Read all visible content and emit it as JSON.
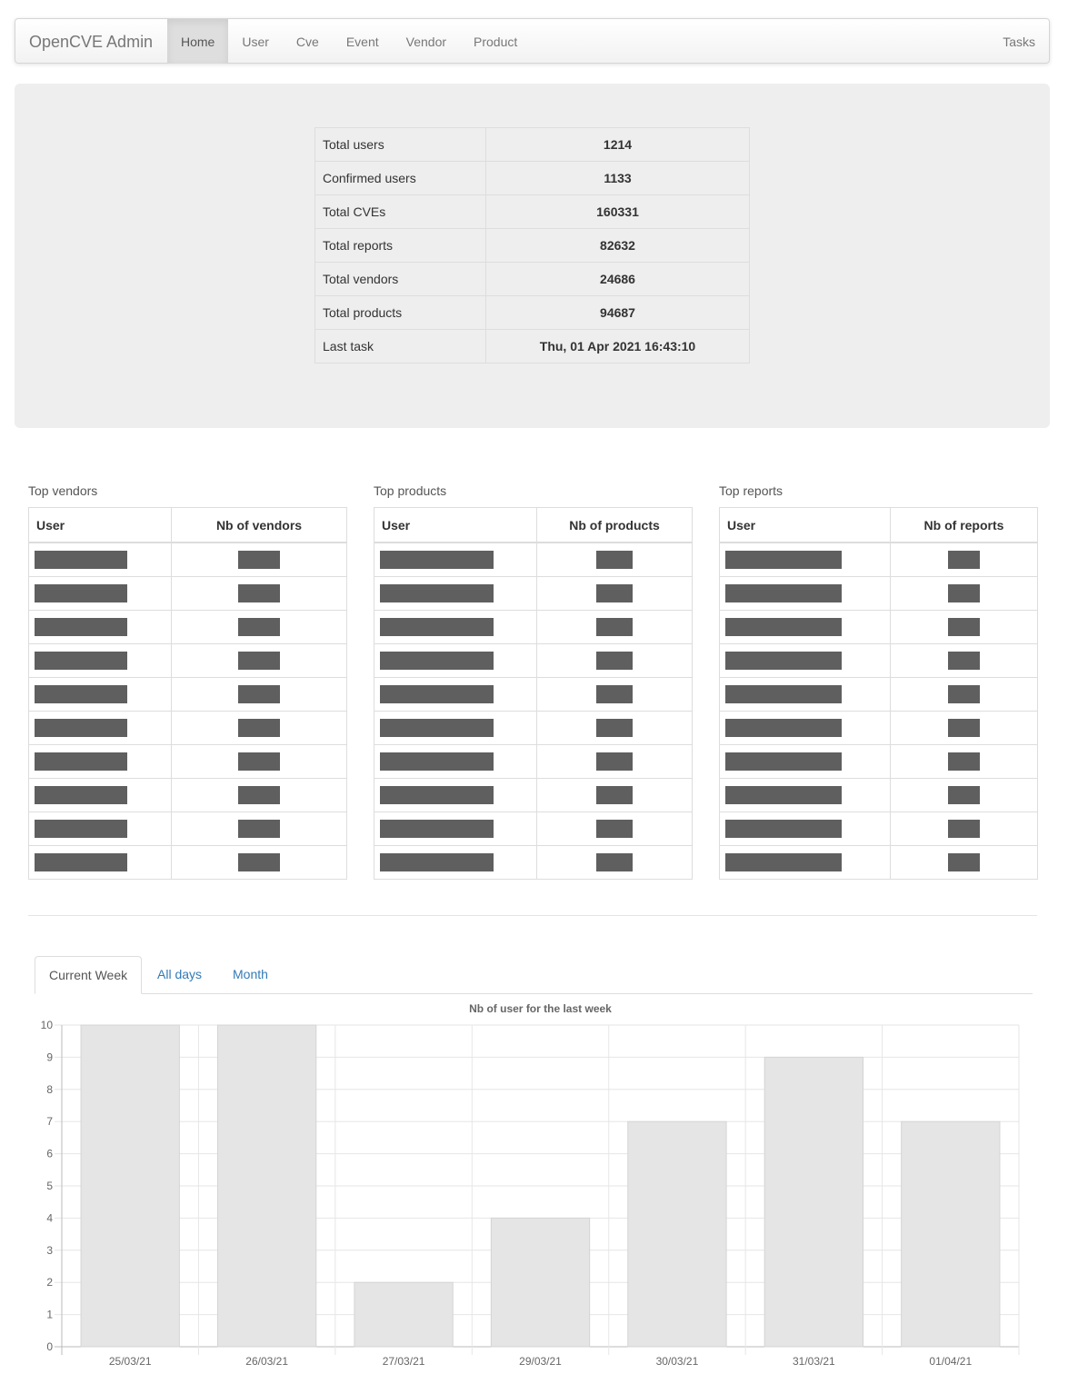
{
  "navbar": {
    "brand": "OpenCVE Admin",
    "items": [
      {
        "label": "Home",
        "active": true
      },
      {
        "label": "User",
        "active": false
      },
      {
        "label": "Cve",
        "active": false
      },
      {
        "label": "Event",
        "active": false
      },
      {
        "label": "Vendor",
        "active": false
      },
      {
        "label": "Product",
        "active": false
      }
    ],
    "right": "Tasks"
  },
  "stats": [
    {
      "label": "Total users",
      "value": "1214"
    },
    {
      "label": "Confirmed users",
      "value": "1133"
    },
    {
      "label": "Total CVEs",
      "value": "160331"
    },
    {
      "label": "Total reports",
      "value": "82632"
    },
    {
      "label": "Total vendors",
      "value": "24686"
    },
    {
      "label": "Total products",
      "value": "94687"
    },
    {
      "label": "Last task",
      "value": "Thu, 01 Apr 2021 16:43:10"
    }
  ],
  "top_vendors": {
    "title": "Top vendors",
    "col_user": "User",
    "col_count": "Nb of vendors",
    "rows": 10
  },
  "top_products": {
    "title": "Top products",
    "col_user": "User",
    "col_count": "Nb of products",
    "rows": 10
  },
  "top_reports": {
    "title": "Top reports",
    "col_user": "User",
    "col_count": "Nb of reports",
    "rows": 10
  },
  "tabs": [
    {
      "label": "Current Week",
      "active": true
    },
    {
      "label": "All days",
      "active": false
    },
    {
      "label": "Month",
      "active": false
    }
  ],
  "colors": {
    "bar_fill": "#e5e5e5",
    "bar_stroke": "#d4d4d4",
    "link": "#337ab7",
    "redaction": "#5f5f5f"
  },
  "chart_data": {
    "type": "bar",
    "title": "Nb of user for the last week",
    "categories": [
      "25/03/21",
      "26/03/21",
      "27/03/21",
      "29/03/21",
      "30/03/21",
      "31/03/21",
      "01/04/21"
    ],
    "values": [
      10,
      10,
      2,
      4,
      7,
      9,
      7
    ],
    "xlabel": "",
    "ylabel": "",
    "ylim": [
      0,
      10
    ],
    "yticks": [
      0,
      1,
      2,
      3,
      4,
      5,
      6,
      7,
      8,
      9,
      10
    ],
    "grid": true,
    "legend": "none"
  }
}
